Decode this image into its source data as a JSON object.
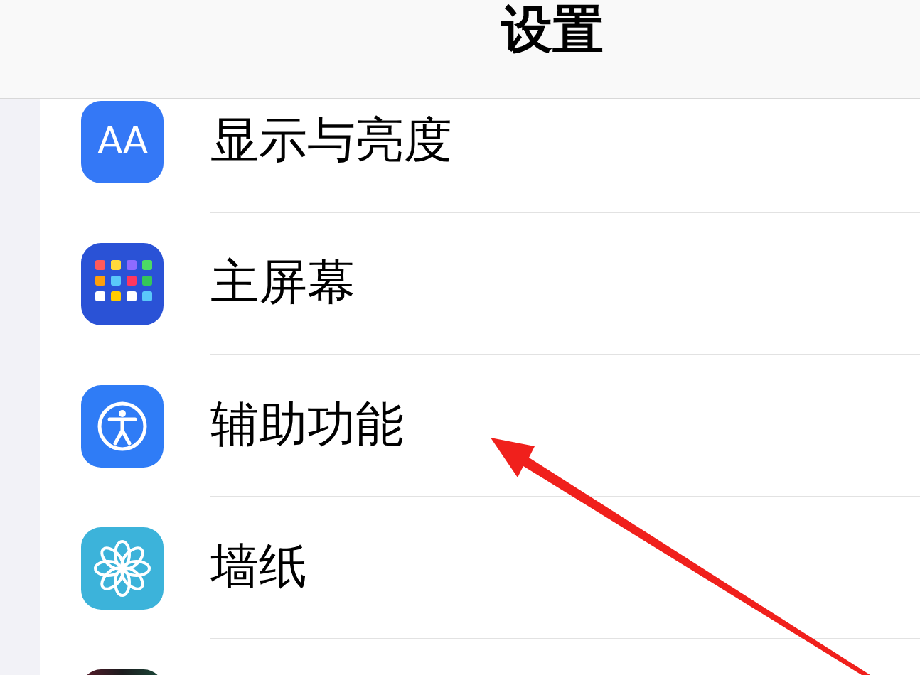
{
  "header": {
    "title": "设置"
  },
  "items": [
    {
      "kind": "display",
      "icon_text": "AA",
      "label": "显示与亮度"
    },
    {
      "kind": "home",
      "label": "主屏幕"
    },
    {
      "kind": "accessibility",
      "label": "辅助功能"
    },
    {
      "kind": "wallpaper",
      "label": "墙纸"
    },
    {
      "kind": "dark"
    }
  ]
}
